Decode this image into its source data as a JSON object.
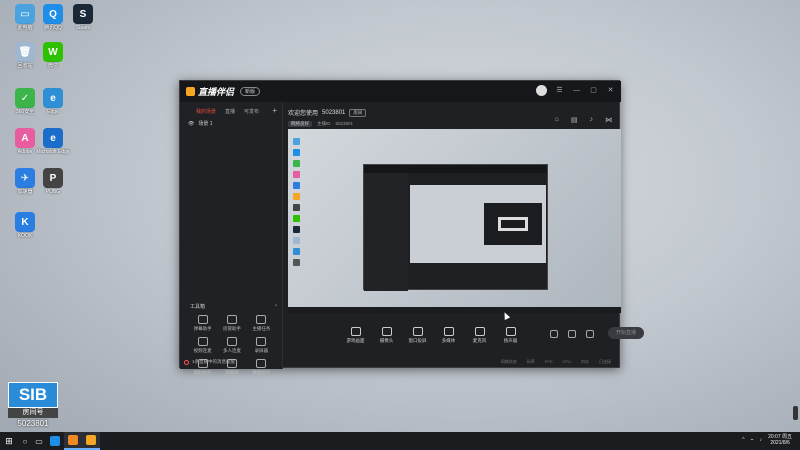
{
  "desktop_icons": [
    {
      "label": "此电脑",
      "color": "#4aa3df",
      "glyph": "▭"
    },
    {
      "label": "腾讯QQ",
      "color": "#1e8fe8",
      "glyph": "Q"
    },
    {
      "label": "Steam",
      "color": "#1b2838",
      "glyph": "S"
    },
    {
      "label": "回收站",
      "color": "#9fb8d0",
      "glyph": "🗑"
    },
    {
      "label": "微信",
      "color": "#2dc100",
      "glyph": "W"
    },
    {
      "label": "360安全",
      "color": "#3bb54a",
      "glyph": "✓"
    },
    {
      "label": "Edge",
      "color": "#2e8fd4",
      "glyph": "e"
    },
    {
      "label": "Adobe",
      "color": "#e85d9f",
      "glyph": "A"
    },
    {
      "label": "Microsoft Edge",
      "color": "#1a6dc8",
      "glyph": "e"
    },
    {
      "label": "加速器",
      "color": "#2a7de1",
      "glyph": "✈"
    },
    {
      "label": "PUBG",
      "color": "#444",
      "glyph": "P"
    },
    {
      "label": "KOOK",
      "color": "#2a7de1",
      "glyph": "K"
    }
  ],
  "watermark": {
    "title": "SIB",
    "subtitle": "房间号",
    "room_id": "5023801"
  },
  "app": {
    "name": "直播伴侣",
    "version_badge": "新版",
    "window_controls": [
      "☰",
      "—",
      "▢",
      "✕"
    ],
    "left_tabs": [
      {
        "label": "我的场景",
        "active": true
      },
      {
        "label": "直播",
        "active": false
      },
      {
        "label": "可发布",
        "active": false
      }
    ],
    "scene_label": "场景 1",
    "tools_title": "工具箱",
    "tools": [
      {
        "label": "弹幕助手"
      },
      {
        "label": "房管助手"
      },
      {
        "label": "主播任务"
      },
      {
        "label": "视频连麦"
      },
      {
        "label": "多人连麦"
      },
      {
        "label": "录屏器"
      },
      {
        "label": "福利抽奖"
      },
      {
        "label": "弹幕库"
      },
      {
        "label": "数据统计"
      }
    ],
    "footer_notice": "1条直播中的消息提醒",
    "welcome": "欢迎您使用",
    "room_number": "5023801",
    "room_button": "房间",
    "sub_pill": "网络良好",
    "sub_items": [
      "主播ID",
      "5023801"
    ],
    "controls": [
      {
        "label": "游戏画面"
      },
      {
        "label": "摄像头"
      },
      {
        "label": "窗口投屏"
      },
      {
        "label": "多媒体"
      },
      {
        "label": "麦克风"
      },
      {
        "label": "扬声器"
      }
    ],
    "start_live": "开始直播",
    "status_items": [
      "网络状态",
      "码率",
      "FPS",
      "CPU",
      "内存",
      "已连接"
    ]
  },
  "taskbar": {
    "start_glyph": "⊞",
    "apps": [
      {
        "color": "#1e8fe8",
        "active": false
      },
      {
        "color": "#f08a24",
        "active": true
      },
      {
        "color": "#f5a623",
        "active": true
      }
    ],
    "time": "20:07 周五",
    "date": "2021/8/6"
  }
}
